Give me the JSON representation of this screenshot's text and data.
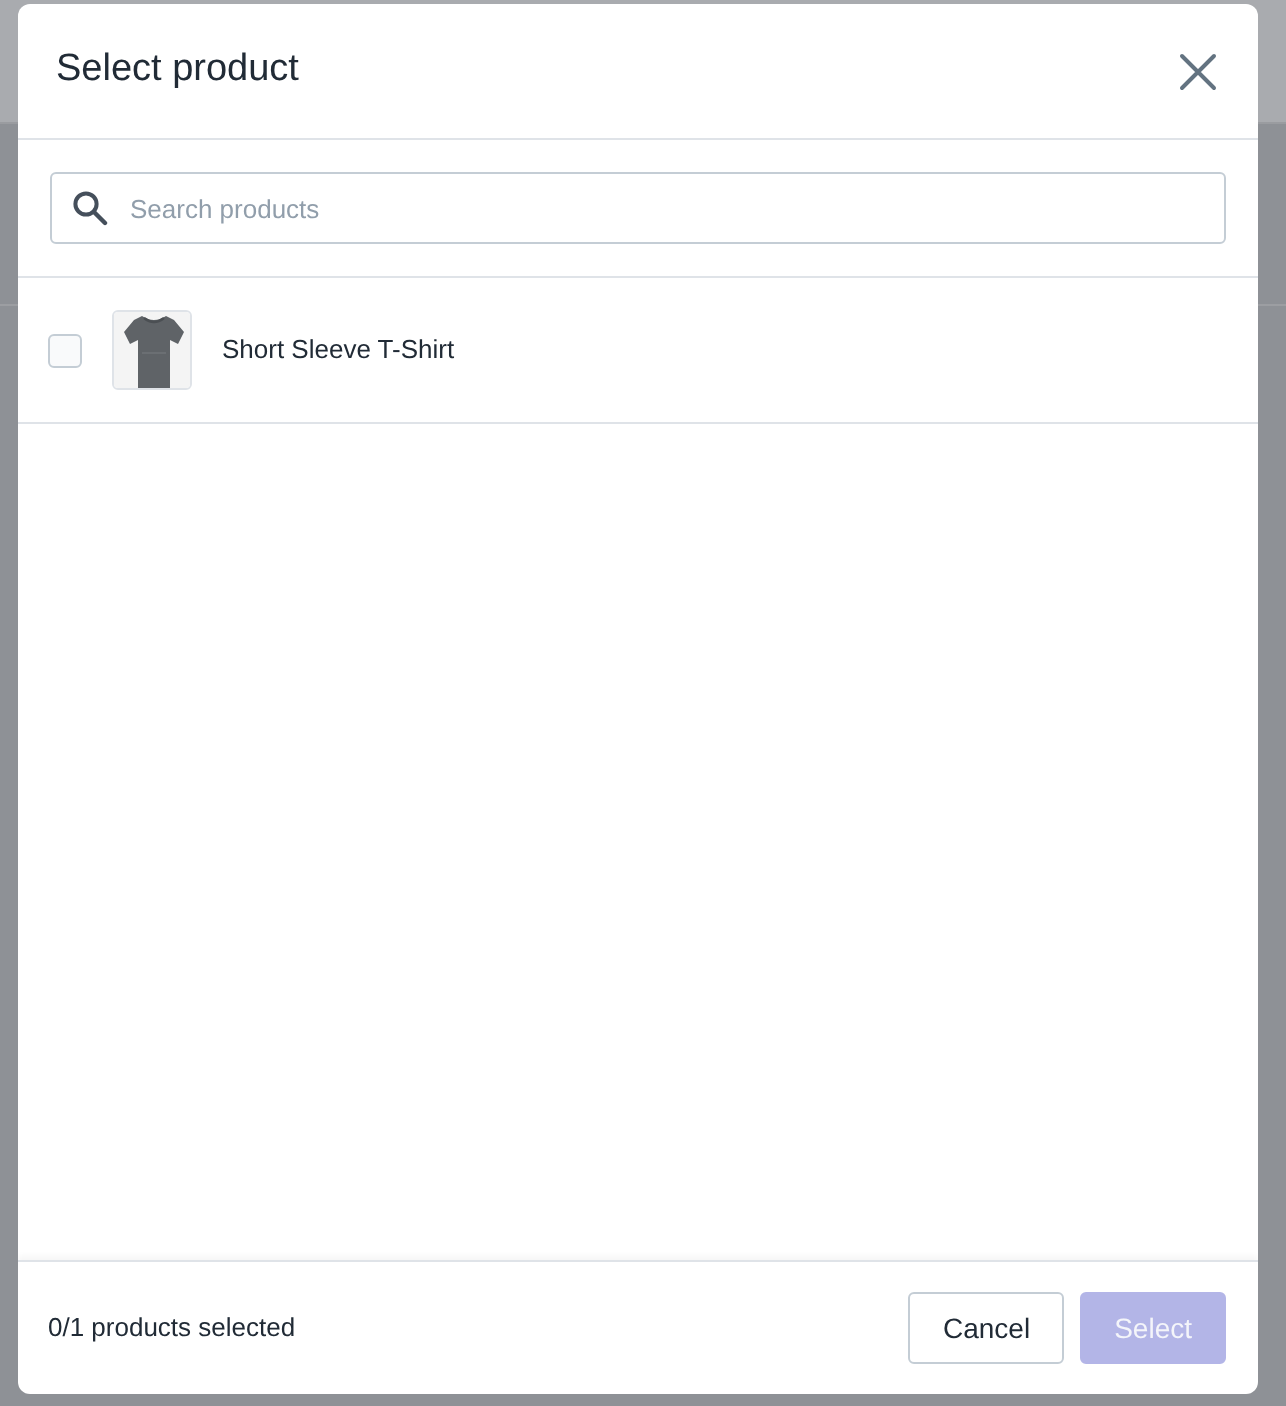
{
  "modal": {
    "title": "Select product"
  },
  "search": {
    "placeholder": "Search products"
  },
  "products": [
    {
      "name": "Short Sleeve T-Shirt",
      "checked": false
    }
  ],
  "footer": {
    "status": "0/1 products selected",
    "buttons": [
      {
        "label": "Cancel",
        "kind": "secondary",
        "disabled": false
      },
      {
        "label": "Select",
        "kind": "primary",
        "disabled": true
      }
    ]
  }
}
